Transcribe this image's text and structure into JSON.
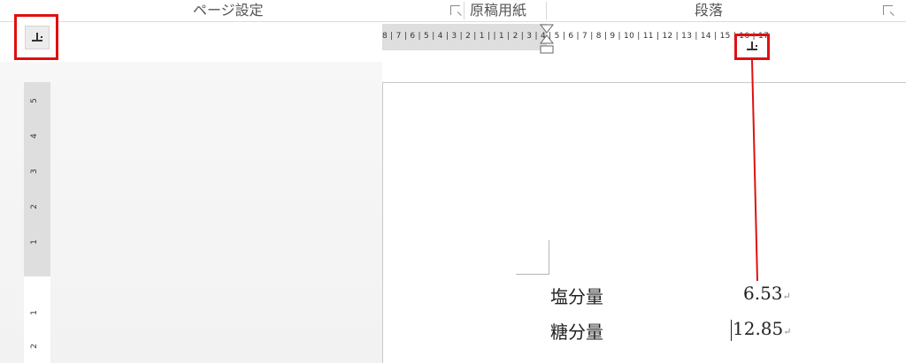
{
  "ribbon": {
    "groups": [
      {
        "label": "ページ設定"
      },
      {
        "label": "原稿用紙"
      },
      {
        "label": "段落"
      }
    ]
  },
  "ruler": {
    "labels": "8 | 7 | 6 | 5 | 4 | 3 | 2 | 1 |           | 1 | 2 | 3 | 4 | 5 | 6 | 7 | 8 | 9 | 10 | 11 | 12 | 13 | 14 | 15 | 16 | 17",
    "vertical_numbers": [
      "5",
      "4",
      "3",
      "2",
      "1",
      "1",
      "2"
    ]
  },
  "document": {
    "rows": [
      {
        "label": "塩分量",
        "value": "6.53"
      },
      {
        "label": "糖分量",
        "value": "12.85"
      }
    ],
    "paragraph_mark": "↵"
  },
  "colors": {
    "highlight": "#e01010"
  }
}
